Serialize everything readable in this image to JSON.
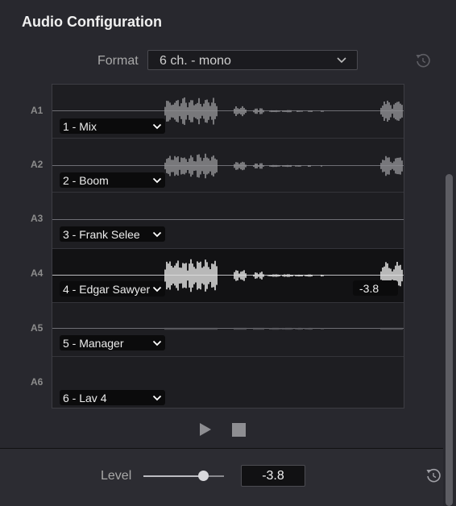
{
  "panel": {
    "title": "Audio Configuration"
  },
  "format": {
    "label": "Format",
    "value": "6 ch. - mono"
  },
  "tracks": [
    {
      "label": "A1",
      "channel": "1 - Mix"
    },
    {
      "label": "A2",
      "channel": "2 - Boom"
    },
    {
      "label": "A3",
      "channel": "3 - Frank Selee"
    },
    {
      "label": "A4",
      "channel": "4 - Edgar Sawyer",
      "level": "-3.8",
      "selected": true
    },
    {
      "label": "A5",
      "channel": "5 - Manager"
    },
    {
      "label": "A6",
      "channel": "6 - Lav 4"
    }
  ],
  "transport": {
    "play_icon": "play-icon",
    "stop_icon": "stop-icon"
  },
  "level": {
    "label": "Level",
    "value": "-3.8",
    "slider_fraction": 0.74
  },
  "icons": {
    "reset": "reset-icon",
    "chevron": "chevron-down-icon"
  },
  "colors": {
    "background": "#28282e",
    "track_bg": "#1e1e22",
    "selected_track_bg": "#121214",
    "waveform": "#8e8e92",
    "waveform_selected": "#e2e2e2"
  }
}
